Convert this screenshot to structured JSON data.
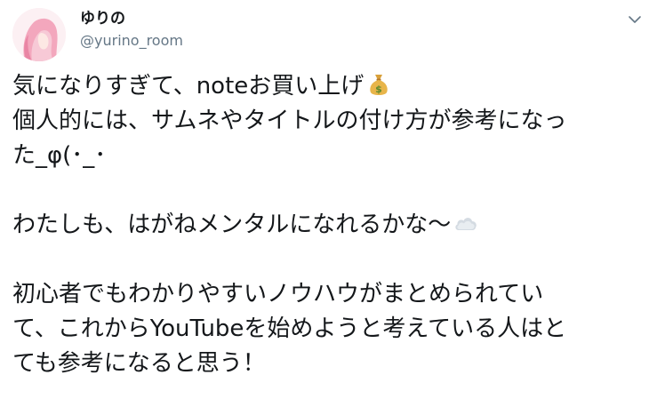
{
  "author": {
    "display_name": "ゆりの",
    "handle": "@yurino_room",
    "avatar_icon": "avatar-illustration-icon"
  },
  "menu": {
    "icon": "chevron-down-icon"
  },
  "tweet": {
    "lines": [
      "気になりすぎて、noteお買い上げ",
      "個人的には、サムネやタイトルの付け方が参考になっ",
      "た_φ(･_･",
      "わたしも、はがねメンタルになれるかな〜",
      "初心者でもわかりやすいノウハウがまとめられてい",
      "て、これからYouTubeを始めようと考えている人はと",
      "ても参考になると思う！"
    ],
    "emojis": [
      "money-bag-icon",
      "cloud-icon"
    ]
  },
  "colors": {
    "text": "#14171a",
    "secondary_text": "#657786",
    "background": "#ffffff"
  }
}
